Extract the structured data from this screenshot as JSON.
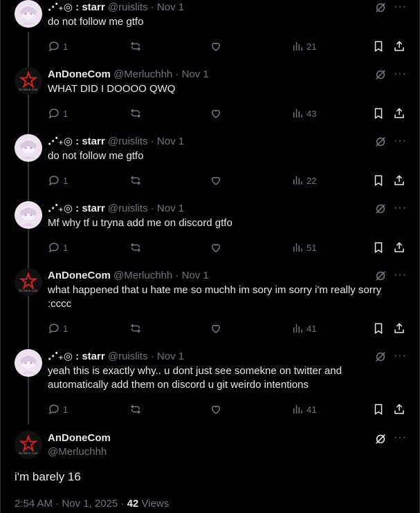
{
  "tweets": [
    {
      "name": "⋰₊◎ : starr",
      "handle": "@ruislits · Nov 1",
      "text": "do not follow me gtfo",
      "replies": "1",
      "views": "21",
      "avatar": "starr"
    },
    {
      "name": "AnDoneCom",
      "handle": "@Merluchhh · Nov 1",
      "text": "WHAT DID I DOOOO QWQ",
      "replies": "1",
      "views": "43",
      "avatar": "andone"
    },
    {
      "name": "⋰₊◎ : starr",
      "handle": "@ruislits · Nov 1",
      "text": "do not follow me gtfo",
      "replies": "1",
      "views": "22",
      "avatar": "starr"
    },
    {
      "name": "⋰₊◎ : starr",
      "handle": "@ruislits · Nov 1",
      "text": "Mf why tf u tryna add me on discord gtfo",
      "replies": "1",
      "views": "51",
      "avatar": "starr"
    },
    {
      "name": "AnDoneCom",
      "handle": "@Merluchhh · Nov 1",
      "text": "what happened that u hate me so muchh im sory im sorry i'm really sorry :cccc",
      "replies": "1",
      "views": "41",
      "avatar": "andone"
    },
    {
      "name": "⋰₊◎ : starr",
      "handle": "@ruislits · Nov 1",
      "text": "yeah this is exactly why.. u dont just see somekne on twitter and automatically add them on discord u git weirdo intentions",
      "replies": "1",
      "views": "41",
      "avatar": "starr"
    }
  ],
  "main": {
    "name": "AnDoneCom",
    "handle": "@Merluchhh",
    "text": "i'm barely 16",
    "time": "2:54 AM · Nov 1, 2025 · ",
    "views_count": "42",
    "views_label": "Views"
  },
  "avatar_text": "An Done Com",
  "icons": [
    "grok-icon",
    "more-icon",
    "reply-icon",
    "retweet-icon",
    "like-icon",
    "views-icon",
    "bookmark-icon",
    "share-icon"
  ],
  "colors": {
    "background": "#000000",
    "text": "#e7e9ea",
    "muted": "#71767b",
    "thread_line": "#333639",
    "logo_red": "#d62222"
  }
}
